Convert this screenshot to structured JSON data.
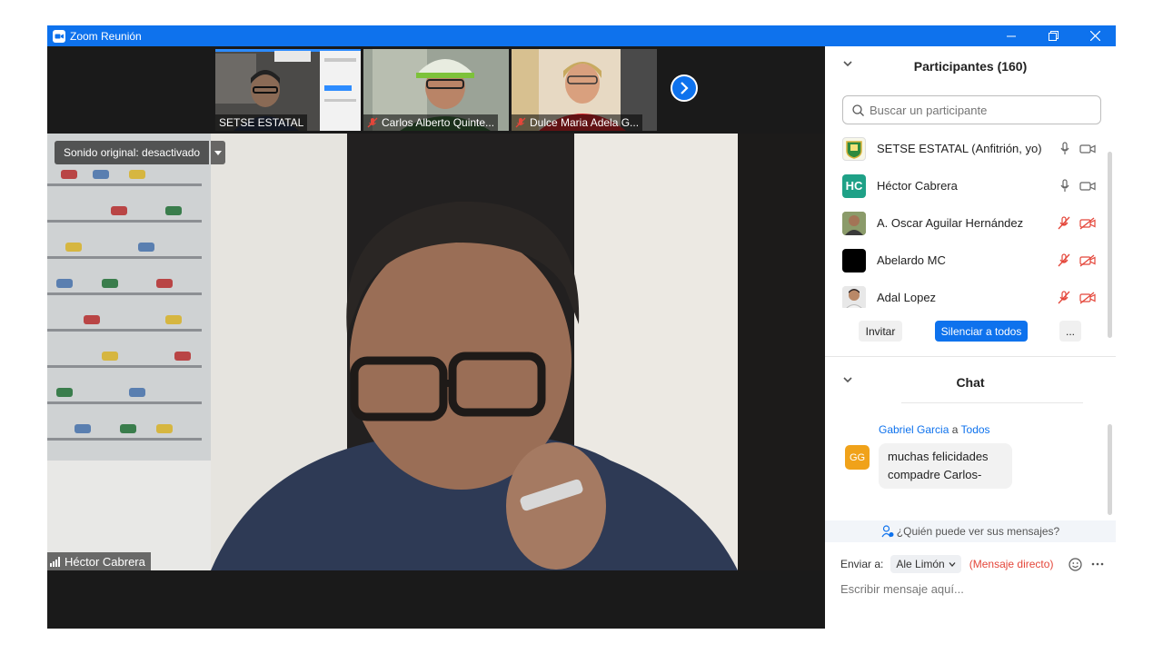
{
  "window": {
    "title": "Zoom Reunión",
    "controls": [
      "minimize",
      "restore",
      "close"
    ]
  },
  "thumbnails": [
    {
      "name": "SETSE ESTATAL",
      "muted": false
    },
    {
      "name": "Carlos Alberto Quinte...",
      "muted": true
    },
    {
      "name": "Dulce Maria Adela G...",
      "muted": true
    }
  ],
  "main_video": {
    "sound_label": "Sonido original: desactivado",
    "speaker_name": "Héctor Cabrera"
  },
  "participants": {
    "header": "Participantes (160)",
    "search_placeholder": "Buscar un participante",
    "list": [
      {
        "name": "SETSE ESTATAL (Anfitrión, yo)",
        "avatar": "logo",
        "mic": "on",
        "video": "on"
      },
      {
        "name": "Héctor Cabrera",
        "initials": "HC",
        "avatar_color": "#1fa187",
        "mic": "on",
        "video": "on"
      },
      {
        "name": "A. Oscar Aguilar Hernández",
        "avatar": "photo",
        "mic": "muted",
        "video": "off"
      },
      {
        "name": "Abelardo MC",
        "avatar": "black",
        "mic": "muted",
        "video": "off"
      },
      {
        "name": "Adal Lopez",
        "avatar": "photo",
        "mic": "muted",
        "video": "off"
      }
    ],
    "buttons": {
      "invite": "Invitar",
      "mute_all": "Silenciar a todos",
      "more": "..."
    }
  },
  "chat": {
    "header": "Chat",
    "messages": [
      {
        "sender": "Gabriel Garcia",
        "connector": "a",
        "recipient": "Todos",
        "initials": "GG",
        "text": "muchas felicidades compadre Carlos-"
      }
    ],
    "who_can_see": "¿Quién puede ver sus mensajes?",
    "send_to_label": "Enviar a:",
    "send_to_value": "Ale Limón",
    "direct_label": "(Mensaje directo)",
    "compose_placeholder": "Escribir mensaje aquí..."
  },
  "colors": {
    "accent": "#0e72ed",
    "muted_red": "#e4463a"
  }
}
